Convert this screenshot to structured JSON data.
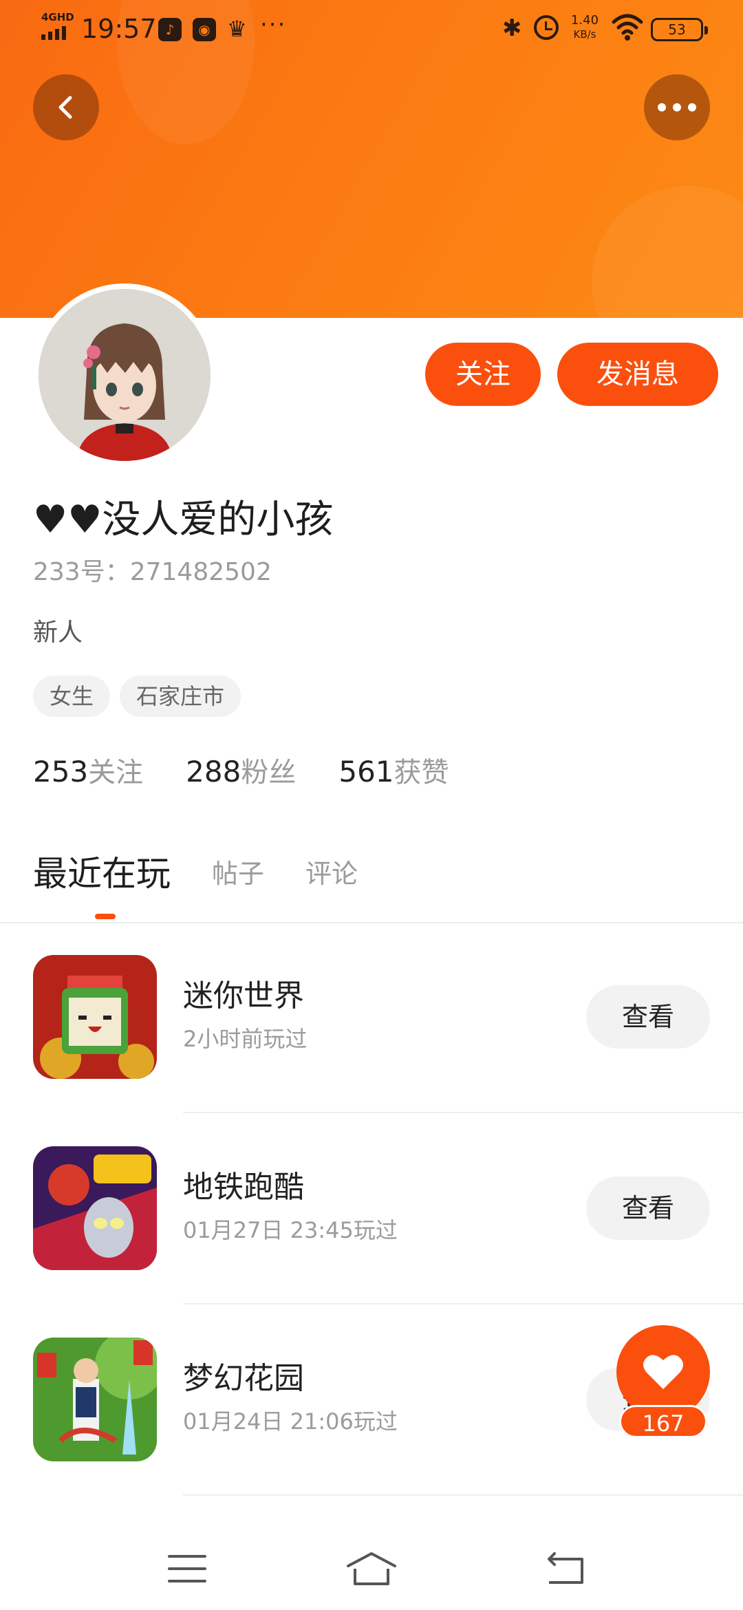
{
  "status_bar": {
    "network": "4GHD",
    "time": "19:57",
    "more": "···",
    "speed_value": "1.40",
    "speed_unit": "KB/s",
    "battery": "53"
  },
  "profile": {
    "nickname": "♥♥没人爱的小孩",
    "uid": "233号：271482502",
    "level": "新人",
    "tags": [
      "女生",
      "石家庄市"
    ],
    "stats": [
      {
        "num": "253",
        "label": "关注"
      },
      {
        "num": "288",
        "label": "粉丝"
      },
      {
        "num": "561",
        "label": "获赞"
      }
    ],
    "follow_label": "关注",
    "message_label": "发消息"
  },
  "tabs": [
    {
      "label": "最近在玩",
      "active": true
    },
    {
      "label": "帖子",
      "active": false
    },
    {
      "label": "评论",
      "active": false
    }
  ],
  "games": [
    {
      "name": "迷你世界",
      "time": "2小时前玩过",
      "action": "查看"
    },
    {
      "name": "地铁跑酷",
      "time": "01月27日 23:45玩过",
      "action": "查看"
    },
    {
      "name": "梦幻花园",
      "time": "01月24日 21:06玩过",
      "action": "查看"
    }
  ],
  "like": {
    "count": "167"
  },
  "colors": {
    "accent": "#fb4f0e",
    "banner": "#fb7a12"
  }
}
